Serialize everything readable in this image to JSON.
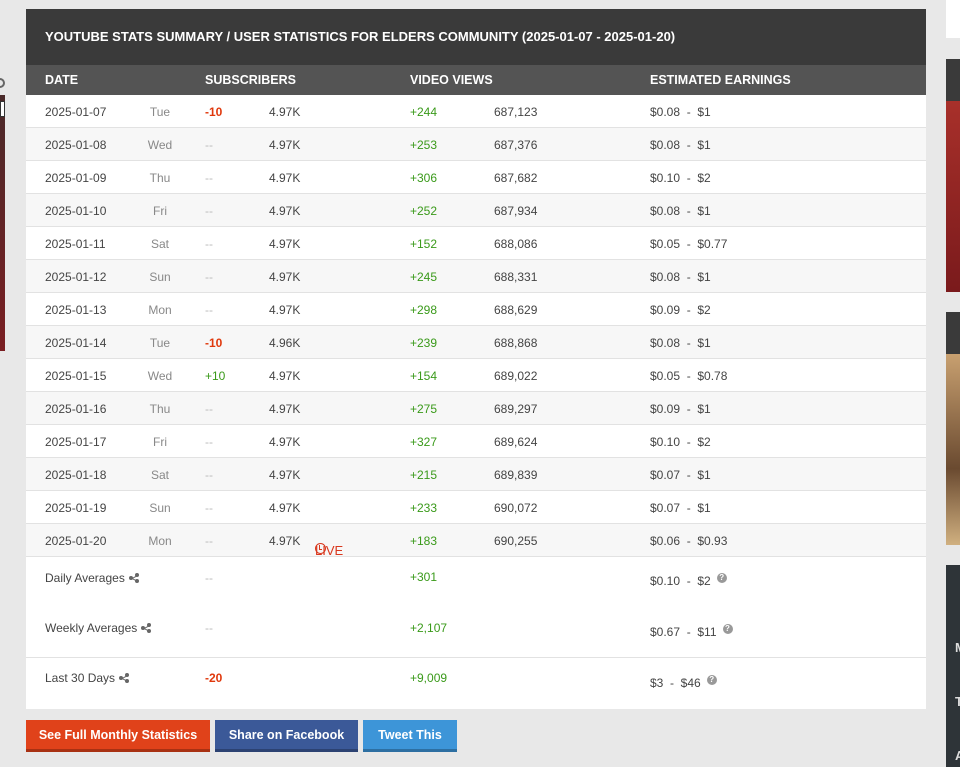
{
  "header": {
    "title": "YOUTUBE STATS SUMMARY / USER STATISTICS FOR ELDERS COMMUNITY (2025-01-07 - 2025-01-20)"
  },
  "columns": {
    "date": "DATE",
    "subscribers": "SUBSCRIBERS",
    "video_views": "VIDEO VIEWS",
    "earnings": "ESTIMATED EARNINGS"
  },
  "rows": [
    {
      "date": "2025-01-07",
      "day": "Tue",
      "sub_change": "-10",
      "subs": "4.97K",
      "views_change": "+244",
      "views": "687,123",
      "earn": "$0.08  -  $1"
    },
    {
      "date": "2025-01-08",
      "day": "Wed",
      "sub_change": "--",
      "subs": "4.97K",
      "views_change": "+253",
      "views": "687,376",
      "earn": "$0.08  -  $1"
    },
    {
      "date": "2025-01-09",
      "day": "Thu",
      "sub_change": "--",
      "subs": "4.97K",
      "views_change": "+306",
      "views": "687,682",
      "earn": "$0.10  -  $2"
    },
    {
      "date": "2025-01-10",
      "day": "Fri",
      "sub_change": "--",
      "subs": "4.97K",
      "views_change": "+252",
      "views": "687,934",
      "earn": "$0.08  -  $1"
    },
    {
      "date": "2025-01-11",
      "day": "Sat",
      "sub_change": "--",
      "subs": "4.97K",
      "views_change": "+152",
      "views": "688,086",
      "earn": "$0.05  -  $0.77"
    },
    {
      "date": "2025-01-12",
      "day": "Sun",
      "sub_change": "--",
      "subs": "4.97K",
      "views_change": "+245",
      "views": "688,331",
      "earn": "$0.08  -  $1"
    },
    {
      "date": "2025-01-13",
      "day": "Mon",
      "sub_change": "--",
      "subs": "4.97K",
      "views_change": "+298",
      "views": "688,629",
      "earn": "$0.09  -  $2"
    },
    {
      "date": "2025-01-14",
      "day": "Tue",
      "sub_change": "-10",
      "subs": "4.96K",
      "views_change": "+239",
      "views": "688,868",
      "earn": "$0.08  -  $1"
    },
    {
      "date": "2025-01-15",
      "day": "Wed",
      "sub_change": "+10",
      "subs": "4.97K",
      "views_change": "+154",
      "views": "689,022",
      "earn": "$0.05  -  $0.78"
    },
    {
      "date": "2025-01-16",
      "day": "Thu",
      "sub_change": "--",
      "subs": "4.97K",
      "views_change": "+275",
      "views": "689,297",
      "earn": "$0.09  -  $1"
    },
    {
      "date": "2025-01-17",
      "day": "Fri",
      "sub_change": "--",
      "subs": "4.97K",
      "views_change": "+327",
      "views": "689,624",
      "earn": "$0.10  -  $2"
    },
    {
      "date": "2025-01-18",
      "day": "Sat",
      "sub_change": "--",
      "subs": "4.97K",
      "views_change": "+215",
      "views": "689,839",
      "earn": "$0.07  -  $1"
    },
    {
      "date": "2025-01-19",
      "day": "Sun",
      "sub_change": "--",
      "subs": "4.97K",
      "views_change": "+233",
      "views": "690,072",
      "earn": "$0.07  -  $1"
    },
    {
      "date": "2025-01-20",
      "day": "Mon",
      "sub_change": "--",
      "subs": "4.97K",
      "views_change": "+183",
      "views": "690,255",
      "earn": "$0.06  -  $0.93",
      "live": "LIVE"
    }
  ],
  "summary": {
    "daily": {
      "label": "Daily Averages",
      "sub": "--",
      "views": "+301",
      "earn": "$0.10  -  $2"
    },
    "weekly": {
      "label": "Weekly Averages",
      "sub": "--",
      "views": "+2,107",
      "earn": "$0.67  -  $11"
    },
    "last30": {
      "label": "Last 30 Days",
      "sub": "-20",
      "views": "+9,009",
      "earn": "$3  -  $46"
    }
  },
  "buttons": {
    "monthly": "See Full Monthly Statistics",
    "facebook": "Share on Facebook",
    "tweet": "Tweet This"
  },
  "side_panel": {
    "letters": [
      "M",
      "T",
      "A"
    ]
  },
  "colors": {
    "negative": "#e0380c",
    "positive": "#3a9a1a",
    "live": "#d9381e",
    "header_dark": "#3a3a3a",
    "column_header": "#545454",
    "button_monthly": "#e0421a",
    "button_facebook": "#3b5998",
    "button_tweet": "#3d95d8"
  }
}
